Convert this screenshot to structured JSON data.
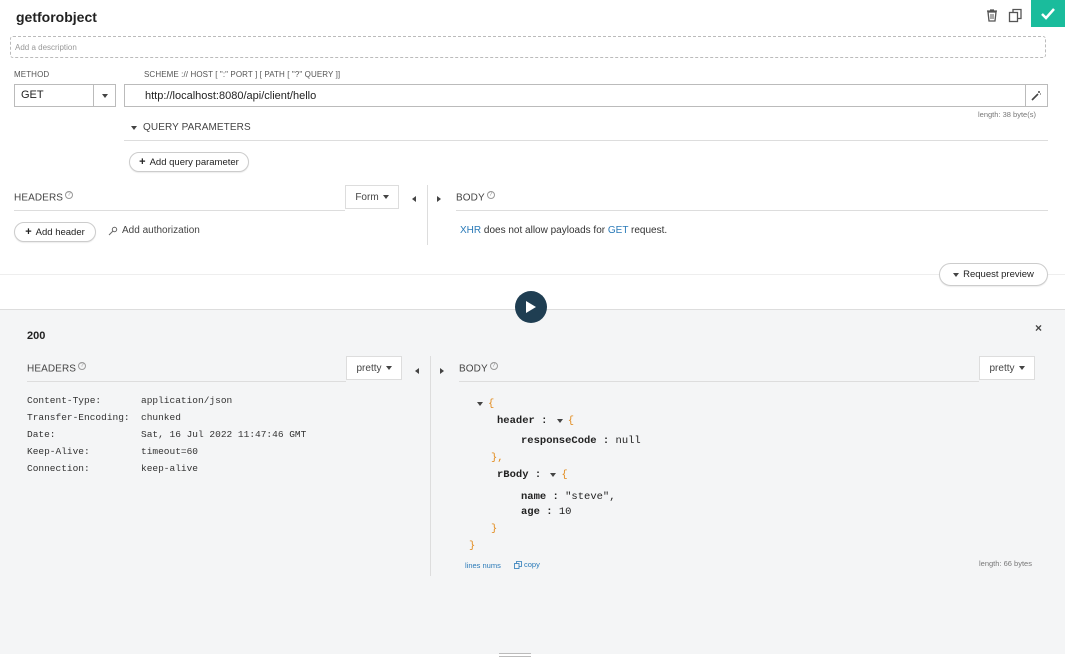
{
  "request": {
    "name": "getforobject",
    "description_placeholder": "Add a description",
    "method_label": "METHOD",
    "method_value": "GET",
    "url_label": "SCHEME :// HOST [ \":\" PORT ] [ PATH [ \"?\" QUERY ]]",
    "url_value": "http://localhost:8080/api/client/hello",
    "url_length": "length: 38 byte(s)",
    "query_params_label": "QUERY PARAMETERS",
    "add_query_param": "Add query parameter",
    "headers_label": "HEADERS",
    "headers_mode": "Form",
    "add_header": "Add header",
    "add_authorization": "Add authorization",
    "body_label": "BODY",
    "body_note_xhr": "XHR",
    "body_note_mid": " does not allow payloads for ",
    "body_note_get": "GET",
    "body_note_end": " request.",
    "request_preview": "Request preview"
  },
  "response": {
    "status": "200",
    "headers_label": "HEADERS",
    "headers_mode": "pretty",
    "headers": [
      {
        "name": "Content-Type:",
        "value": "application/json"
      },
      {
        "name": "Transfer-Encoding:",
        "value": "chunked"
      },
      {
        "name": "Date:",
        "value": "Sat, 16 Jul 2022 11:47:46 GMT"
      },
      {
        "name": "Keep-Alive:",
        "value": "timeout=60"
      },
      {
        "name": "Connection:",
        "value": "keep-alive"
      }
    ],
    "body_label": "BODY",
    "body_mode": "pretty",
    "json": {
      "open": "{",
      "header_key": "header",
      "responseCode_key": "responseCode",
      "responseCode_val": "null",
      "header_close": "},",
      "rBody_key": "rBody",
      "name_key": "name",
      "name_val": "\"steve\",",
      "age_key": "age",
      "age_val": "10",
      "rBody_close": "}",
      "close": "}"
    },
    "lines_nums": "lines nums",
    "copy": "copy",
    "body_length": "length: 66 bytes"
  },
  "colors": {
    "accent": "#1abc9c",
    "play": "#1f3e52",
    "link": "#2a7ab8",
    "brace": "#e28a1b"
  }
}
